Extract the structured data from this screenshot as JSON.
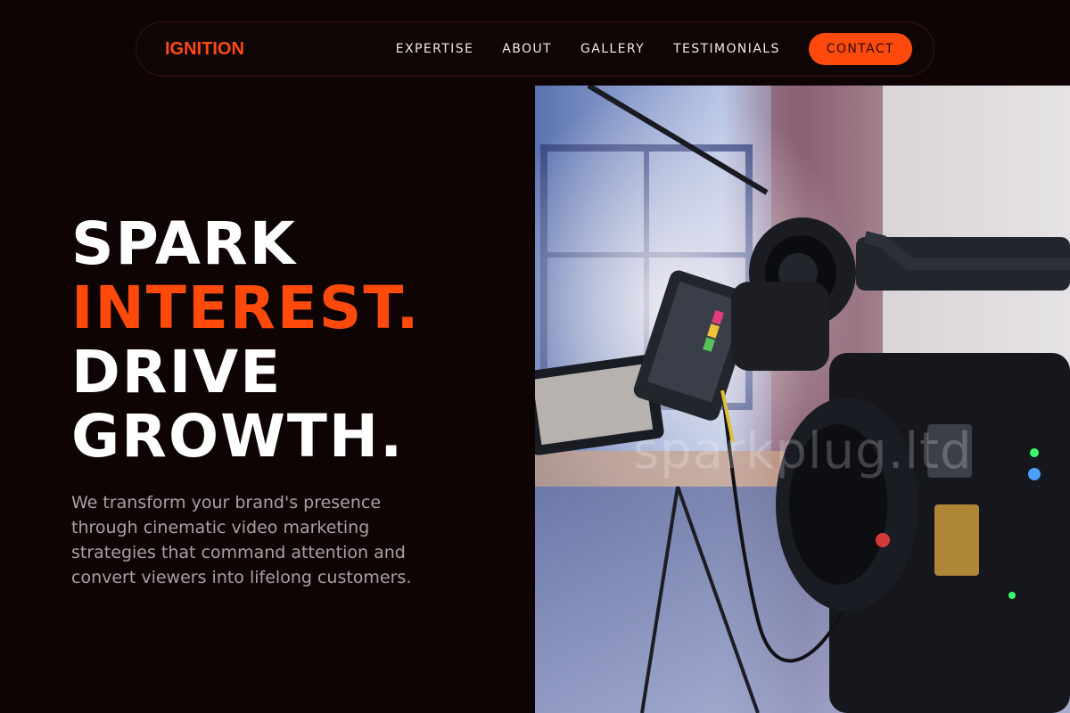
{
  "nav": {
    "logo": "IGNITION",
    "links": [
      "EXPERTISE",
      "ABOUT",
      "GALLERY",
      "TESTIMONIALS"
    ],
    "cta": "CONTACT"
  },
  "hero": {
    "headline": [
      "SPARK",
      "INTEREST.",
      "DRIVE",
      "GROWTH."
    ],
    "subtext": "We transform your brand's presence through cinematic video marketing strategies that command attention and convert viewers into lifelong customers."
  },
  "image": {
    "watermark": "sparkplug.ltd"
  },
  "colors": {
    "background": "#0e0404",
    "accent": "#ff4a0c",
    "text": "#ffffff",
    "muted": "#a9a2a2"
  }
}
